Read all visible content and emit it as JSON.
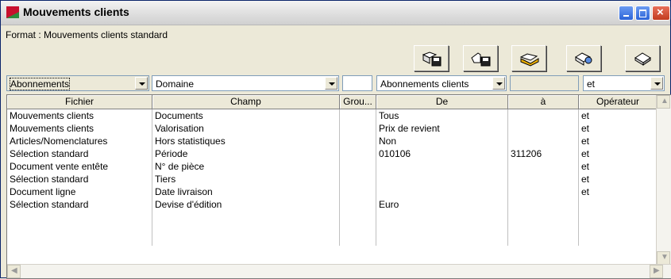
{
  "window": {
    "title": "Mouvements clients"
  },
  "format": {
    "label": "Format : Mouvements clients standard"
  },
  "toolbar": {
    "buttons": [
      {
        "name": "save-format-icon"
      },
      {
        "name": "save-as-format-icon"
      },
      {
        "name": "open-format-icon"
      },
      {
        "name": "settings-format-icon"
      },
      {
        "name": "delete-format-icon"
      }
    ]
  },
  "filters": {
    "fichier": "Abonnements",
    "champ": "Domaine",
    "groupe": "",
    "de": "Abonnements clients",
    "a": "",
    "operateur": "et"
  },
  "table": {
    "headers": {
      "fichier": "Fichier",
      "champ": "Champ",
      "groupe": "Grou...",
      "de": "De",
      "a": "à",
      "operateur": "Opérateur"
    },
    "rows": [
      {
        "fichier": "Mouvements clients",
        "champ": "Documents",
        "groupe": "",
        "de": "Tous",
        "a": "",
        "operateur": "et"
      },
      {
        "fichier": "Mouvements clients",
        "champ": "Valorisation",
        "groupe": "",
        "de": "Prix de revient",
        "a": "",
        "operateur": "et"
      },
      {
        "fichier": "Articles/Nomenclatures",
        "champ": "Hors statistiques",
        "groupe": "",
        "de": "Non",
        "a": "",
        "operateur": "et"
      },
      {
        "fichier": "Sélection standard",
        "champ": "Période",
        "groupe": "",
        "de": "010106",
        "a": "311206",
        "operateur": "et"
      },
      {
        "fichier": "Document vente entête",
        "champ": "N° de pièce",
        "groupe": "",
        "de": "",
        "a": "",
        "operateur": "et"
      },
      {
        "fichier": "Sélection standard",
        "champ": "Tiers",
        "groupe": "",
        "de": "",
        "a": "",
        "operateur": "et"
      },
      {
        "fichier": "Document ligne",
        "champ": "Date livraison",
        "groupe": "",
        "de": "",
        "a": "",
        "operateur": "et"
      },
      {
        "fichier": "Sélection standard",
        "champ": "Devise d'édition",
        "groupe": "",
        "de": "Euro",
        "a": "",
        "operateur": ""
      }
    ]
  }
}
